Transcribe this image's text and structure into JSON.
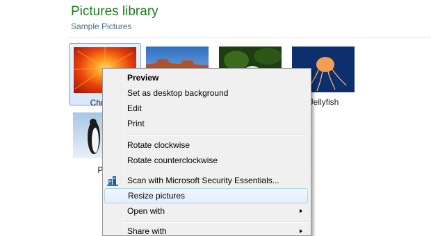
{
  "library": {
    "title": "Pictures library",
    "subtitle": "Sample Pictures"
  },
  "tiles": [
    {
      "label": "Chrysan",
      "thumbnail": "chrysanthemum-photo",
      "selected": true
    },
    {
      "label": "",
      "thumbnail": "desert-photo",
      "selected": false
    },
    {
      "label": "",
      "thumbnail": "hydrangeas-photo",
      "selected": false
    },
    {
      "label": "Jellyfish",
      "thumbnail": "jellyfish-photo",
      "selected": false
    },
    {
      "label": "Pen",
      "thumbnail": "penguins-photo",
      "selected": false
    }
  ],
  "context_menu": {
    "items": [
      {
        "label": "Preview",
        "bold": true
      },
      {
        "label": "Set as desktop background"
      },
      {
        "label": "Edit"
      },
      {
        "label": "Print"
      },
      {
        "label": "Rotate clockwise"
      },
      {
        "label": "Rotate counterclockwise"
      },
      {
        "label": "Scan with Microsoft Security Essentials...",
        "icon": "microsoft-security-essentials-icon"
      },
      {
        "label": "Resize pictures",
        "highlighted": true
      },
      {
        "label": "Open with",
        "submenu": true
      },
      {
        "label": "Share with",
        "submenu": true
      }
    ]
  },
  "colors": {
    "library_title": "#1e7a1e",
    "library_subtitle": "#4a6e8a",
    "menu_background": "#f0f0f0",
    "menu_highlight_border": "#aecff7",
    "selection_border": "#7da2ce"
  }
}
